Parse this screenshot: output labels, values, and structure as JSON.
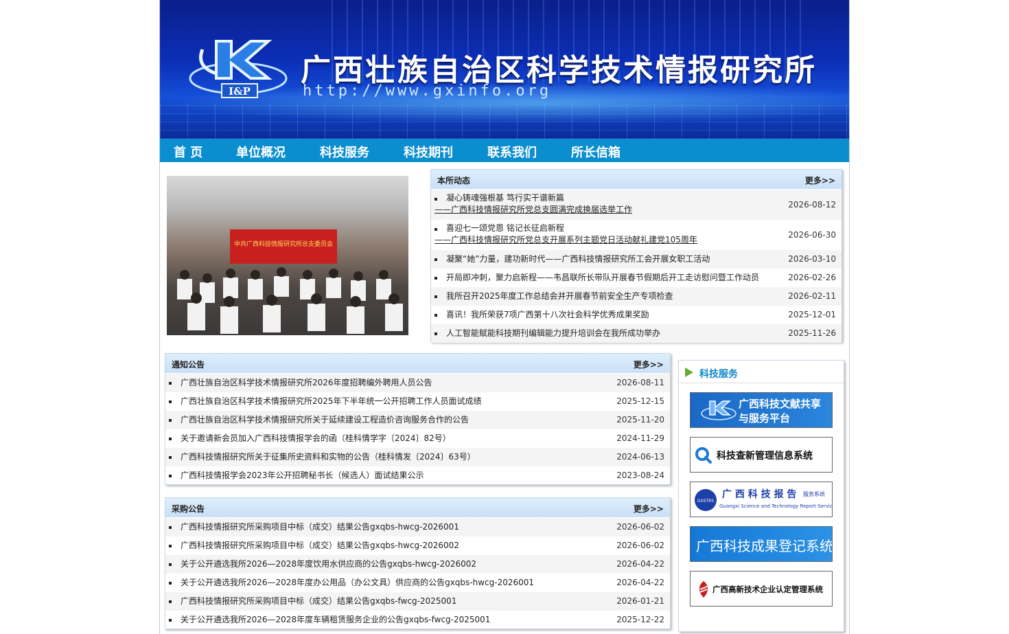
{
  "header": {
    "site_title": "广西壮族自治区科学技术情报研究所",
    "site_url": "http://www.gxinfo.org",
    "logo_text": "I&P"
  },
  "nav": {
    "items": [
      {
        "label": "首 页"
      },
      {
        "label": "单位概况"
      },
      {
        "label": "科技服务"
      },
      {
        "label": "科技期刊"
      },
      {
        "label": "联系我们"
      },
      {
        "label": "所长信箱"
      }
    ]
  },
  "photo": {
    "banner_text": "中共广西科技情报研究所总支委员会"
  },
  "news": {
    "title": "本所动态",
    "more": "更多>>",
    "items": [
      {
        "title": "凝心铸魂强根基 笃行实干谱新篇",
        "subtitle": "——广西科技情报研究所党总支圆满完成换届选举工作",
        "date": "2026-08-12"
      },
      {
        "title": "喜迎七一颂党恩 铭记长征启新程",
        "subtitle": "——广西科技情报研究所党总支开展系列主题党日活动献礼建党105周年",
        "date": "2026-06-30"
      },
      {
        "title": "凝聚“她”力量，建功新时代——广西科技情报研究所工会开展女职工活动",
        "date": "2026-03-10"
      },
      {
        "title": "开局即冲刺，聚力启新程——韦昌联所长带队开展春节假期后开工走访慰问暨工作动员",
        "date": "2026-02-26"
      },
      {
        "title": "我所召开2025年度工作总结会并开展春节前安全生产专项检查",
        "date": "2026-02-11"
      },
      {
        "title": "喜讯！我所荣获7项广西第十八次社会科学优秀成果奖励",
        "date": "2025-12-01"
      },
      {
        "title": "人工智能赋能科技期刊编辑能力提升培训会在我所成功举办",
        "date": "2025-11-26"
      }
    ]
  },
  "notices": {
    "title": "通知公告",
    "more": "更多>>",
    "items": [
      {
        "title": "广西壮族自治区科学技术情报研究所2026年度招聘编外聘用人员公告",
        "date": "2026-08-11"
      },
      {
        "title": "广西壮族自治区科学技术情报研究所2025年下半年统一公开招聘工作人员面试成绩",
        "date": "2025-12-15"
      },
      {
        "title": "广西壮族自治区科学技术情报研究所关于延续建设工程造价咨询服务合作的公告",
        "date": "2025-11-20"
      },
      {
        "title": "关于邀请新会员加入广西科技情报学会的函（桂科情学字〔2024〕82号）",
        "date": "2024-11-29"
      },
      {
        "title": "广西科技情报研究所关于征集所史资料和实物的公告（桂科情发〔2024〕63号）",
        "date": "2024-06-13"
      },
      {
        "title": "广西科技情报学会2023年公开招聘秘书长（候选人）面试结果公示",
        "date": "2023-08-24"
      }
    ]
  },
  "procurement": {
    "title": "采购公告",
    "more": "更多>>",
    "items": [
      {
        "title": "广西科技情报研究所采购项目中标（成交）结果公告gxqbs-hwcg-2026001",
        "date": "2026-06-02"
      },
      {
        "title": "广西科技情报研究所采购项目中标（成交）结果公告gxqbs-hwcg-2026002",
        "date": "2026-06-02"
      },
      {
        "title": "关于公开遴选我所2026—2028年度饮用水供应商的公告gxqbs-hwcg-2026002",
        "date": "2026-04-22"
      },
      {
        "title": "关于公开遴选我所2026—2028年度办公用品（办公文具）供应商的公告gxqbs-hwcg-2026001",
        "date": "2026-04-22"
      },
      {
        "title": "广西科技情报研究所采购项目中标（成交）结果公告gxqbs-fwcg-2025001",
        "date": "2026-01-21"
      },
      {
        "title": "关于公开遴选我所2026—2028年度车辆租赁服务企业的公告gxqbs-fwcg-2025001",
        "date": "2025-12-22"
      }
    ]
  },
  "services": {
    "title": "科技服务",
    "cards": [
      {
        "line1": "广西科技文献共享",
        "line2": "与服务平台"
      },
      {
        "line1": "科技查新管理信息系统"
      },
      {
        "line1": "广 西 科 技 报 告",
        "tag": "服务系统",
        "sub": "Guangxi Science and Technology Report Service",
        "badge": "GXSTRS"
      },
      {
        "line1": "广西科技成果登记系统"
      },
      {
        "line1": "广西高新技术企业认定管理系统"
      }
    ]
  },
  "colors": {
    "nav_bg": "#0a8ed0",
    "box_head": "#c9e0f7",
    "service_title": "#1288c8"
  }
}
